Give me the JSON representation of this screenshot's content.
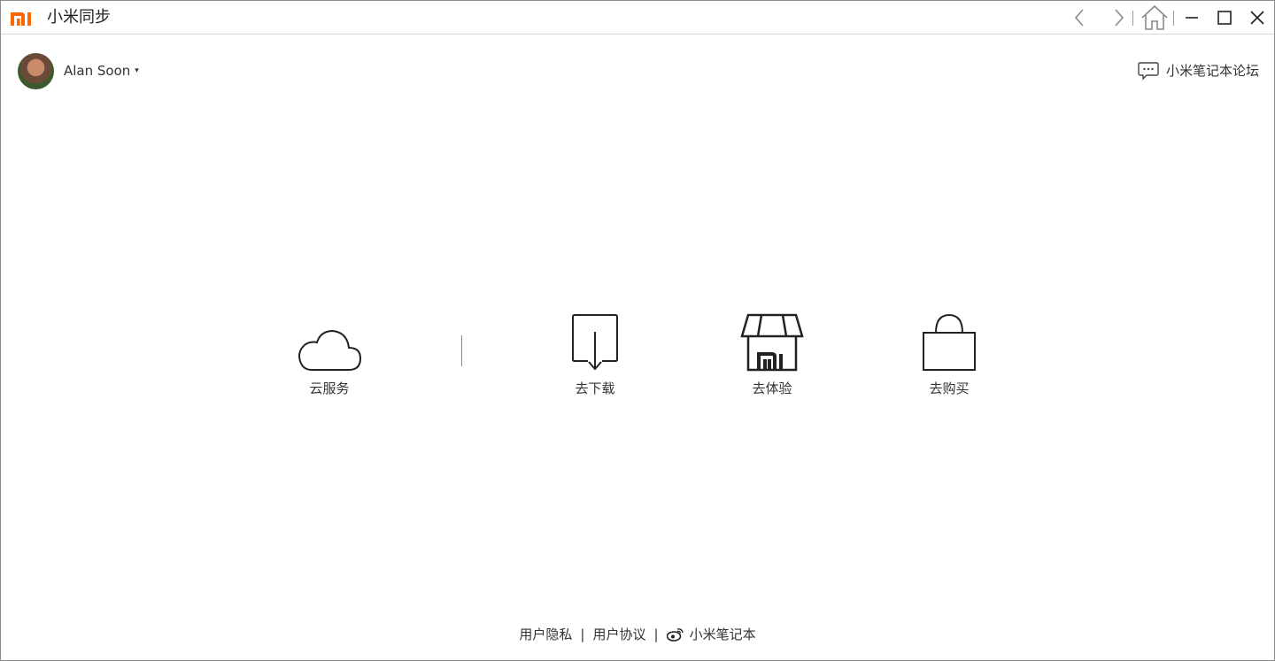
{
  "app": {
    "title": "小米同步",
    "brand_color": "#ff6700"
  },
  "titlebar": {
    "back_icon": "chevron-left-icon",
    "forward_icon": "chevron-right-icon",
    "home_icon": "home-icon",
    "minimize_icon": "minimize-icon",
    "maximize_icon": "maximize-icon",
    "close_icon": "close-icon"
  },
  "user": {
    "name": "Alan Soon",
    "caret": "▾"
  },
  "forum": {
    "label": "小米笔记本论坛",
    "icon": "chat-bubble-icon"
  },
  "actions": [
    {
      "label": "云服务",
      "icon": "cloud-icon"
    },
    {
      "label": "去下载",
      "icon": "download-icon"
    },
    {
      "label": "去体验",
      "icon": "store-icon"
    },
    {
      "label": "去购买",
      "icon": "shopping-bag-icon"
    }
  ],
  "footer": {
    "privacy": "用户隐私",
    "separator": "|",
    "agreement": "用户协议",
    "weibo_label": "小米笔记本",
    "weibo_icon": "weibo-icon"
  }
}
